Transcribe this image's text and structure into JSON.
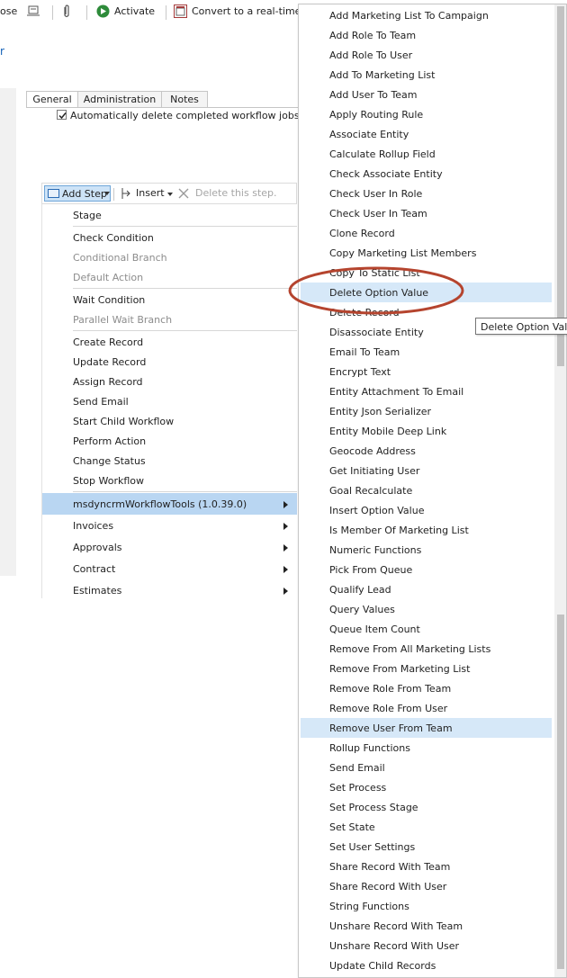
{
  "toolbar": {
    "close_fragment": "ose",
    "activate_label": "Activate",
    "convert_label": "Convert to a real-time w"
  },
  "left_link": "r",
  "tabs": [
    "General",
    "Administration",
    "Notes"
  ],
  "checkbox_label": "Automatically delete completed workflow jobs (to sa",
  "step_toolbar": {
    "add_step": "Add Step",
    "insert": "Insert",
    "delete": "Delete this step."
  },
  "left_menu": [
    {
      "label": "Stage"
    },
    {
      "label": "Check Condition"
    },
    {
      "label": "Conditional Branch"
    },
    {
      "label": "Default Action"
    },
    {
      "label": "Wait Condition"
    },
    {
      "label": "Parallel Wait Branch"
    },
    {
      "label": "Create Record"
    },
    {
      "label": "Update Record"
    },
    {
      "label": "Assign Record"
    },
    {
      "label": "Send Email"
    },
    {
      "label": "Start Child Workflow"
    },
    {
      "label": "Perform Action"
    },
    {
      "label": "Change Status"
    },
    {
      "label": "Stop Workflow"
    },
    {
      "label": "msdyncrmWorkflowTools (1.0.39.0)"
    },
    {
      "label": "Invoices"
    },
    {
      "label": "Approvals"
    },
    {
      "label": "Contract"
    },
    {
      "label": "Estimates"
    }
  ],
  "right_menu": [
    "Add Marketing List To Campaign",
    "Add Role To Team",
    "Add Role To User",
    "Add To Marketing List",
    "Add User To Team",
    "Apply Routing Rule",
    "Associate Entity",
    "Calculate Rollup Field",
    "Check Associate Entity",
    "Check User In Role",
    "Check User In Team",
    "Clone Record",
    "Copy Marketing List Members",
    "Copy To Static List",
    "Delete Option Value",
    "Delete Record",
    "Disassociate Entity",
    "Email To Team",
    "Encrypt Text",
    "Entity Attachment To Email",
    "Entity Json Serializer",
    "Entity Mobile Deep Link",
    "Geocode Address",
    "Get Initiating User",
    "Goal Recalculate",
    "Insert Option Value",
    "Is Member Of Marketing List",
    "Numeric Functions",
    "Pick From Queue",
    "Qualify Lead",
    "Query Values",
    "Queue Item Count",
    "Remove From All Marketing Lists",
    "Remove From Marketing List",
    "Remove Role From Team",
    "Remove Role From User",
    "Remove User From Team",
    "Rollup Functions",
    "Send Email",
    "Set Process",
    "Set Process Stage",
    "Set State",
    "Set User Settings",
    "Share Record With Team",
    "Share Record With User",
    "String Functions",
    "Unshare Record With Team",
    "Unshare Record With User",
    "Update Child Records"
  ],
  "tooltip": "Delete Option Value",
  "colors": {
    "highlight": "#b9d6f2",
    "hover": "#d6e8f8",
    "annotation": "#b5442e",
    "link": "#1160b7"
  }
}
